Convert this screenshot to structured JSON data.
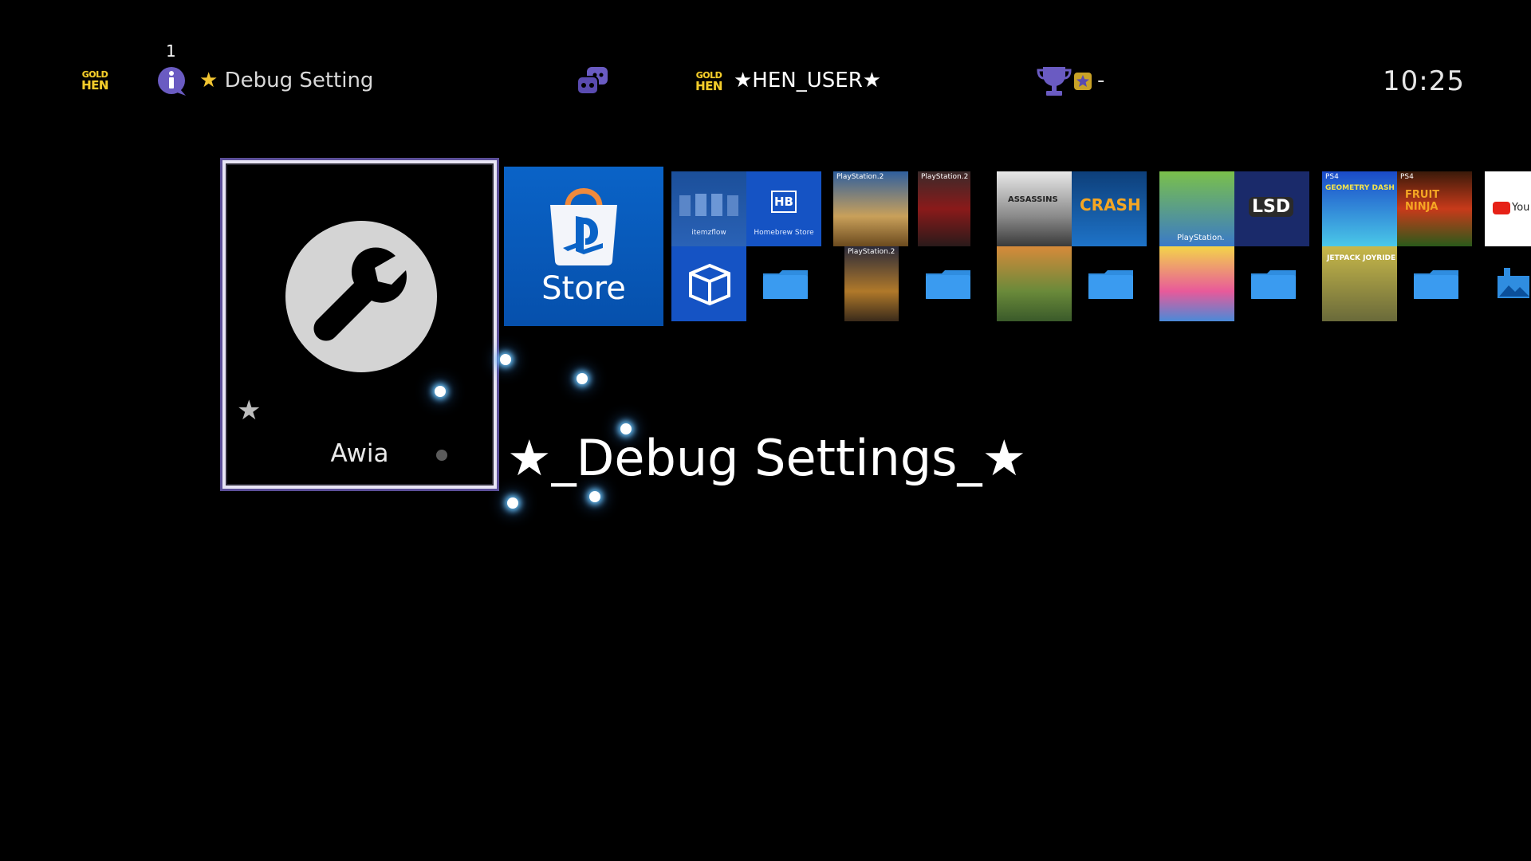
{
  "top_bar": {
    "logo_text_1": "GOLD",
    "logo_text_2": "HEN",
    "notification_count": "1",
    "notification_text": "Debug Setting",
    "notification_star": "★",
    "user_logo_text_1": "GOLD",
    "user_logo_text_2": "HEN",
    "username": "★HEN_USER★",
    "trophy_level": "-",
    "clock": "10:25"
  },
  "focused_app": {
    "label": "Awia",
    "title": "★_Debug Settings_★",
    "icon": "wrench-icon"
  },
  "content_row": {
    "store_label": "Store",
    "itemzflow_label": "itemzflow",
    "hb_logo": "HB",
    "hb_label": "Homebrew Store",
    "crash_text": "CRASH",
    "lsd_text": "LSD",
    "playstation_text": "PlayStation.",
    "ps2_label": "PlayStation.2",
    "ps4_label": "PS4",
    "assassins_text": "ASSASSINS",
    "geometry_text": "GEOMETRY DASH",
    "fruit_text": "FRUIT NINJA",
    "jetpack_text": "JETPACK JOYRIDE",
    "youtube_text": "You"
  },
  "colors": {
    "accent": "#5c4f99",
    "store_blue": "#0a63c7",
    "folder_blue": "#2f8de0",
    "gold": "#f2cc2b"
  }
}
